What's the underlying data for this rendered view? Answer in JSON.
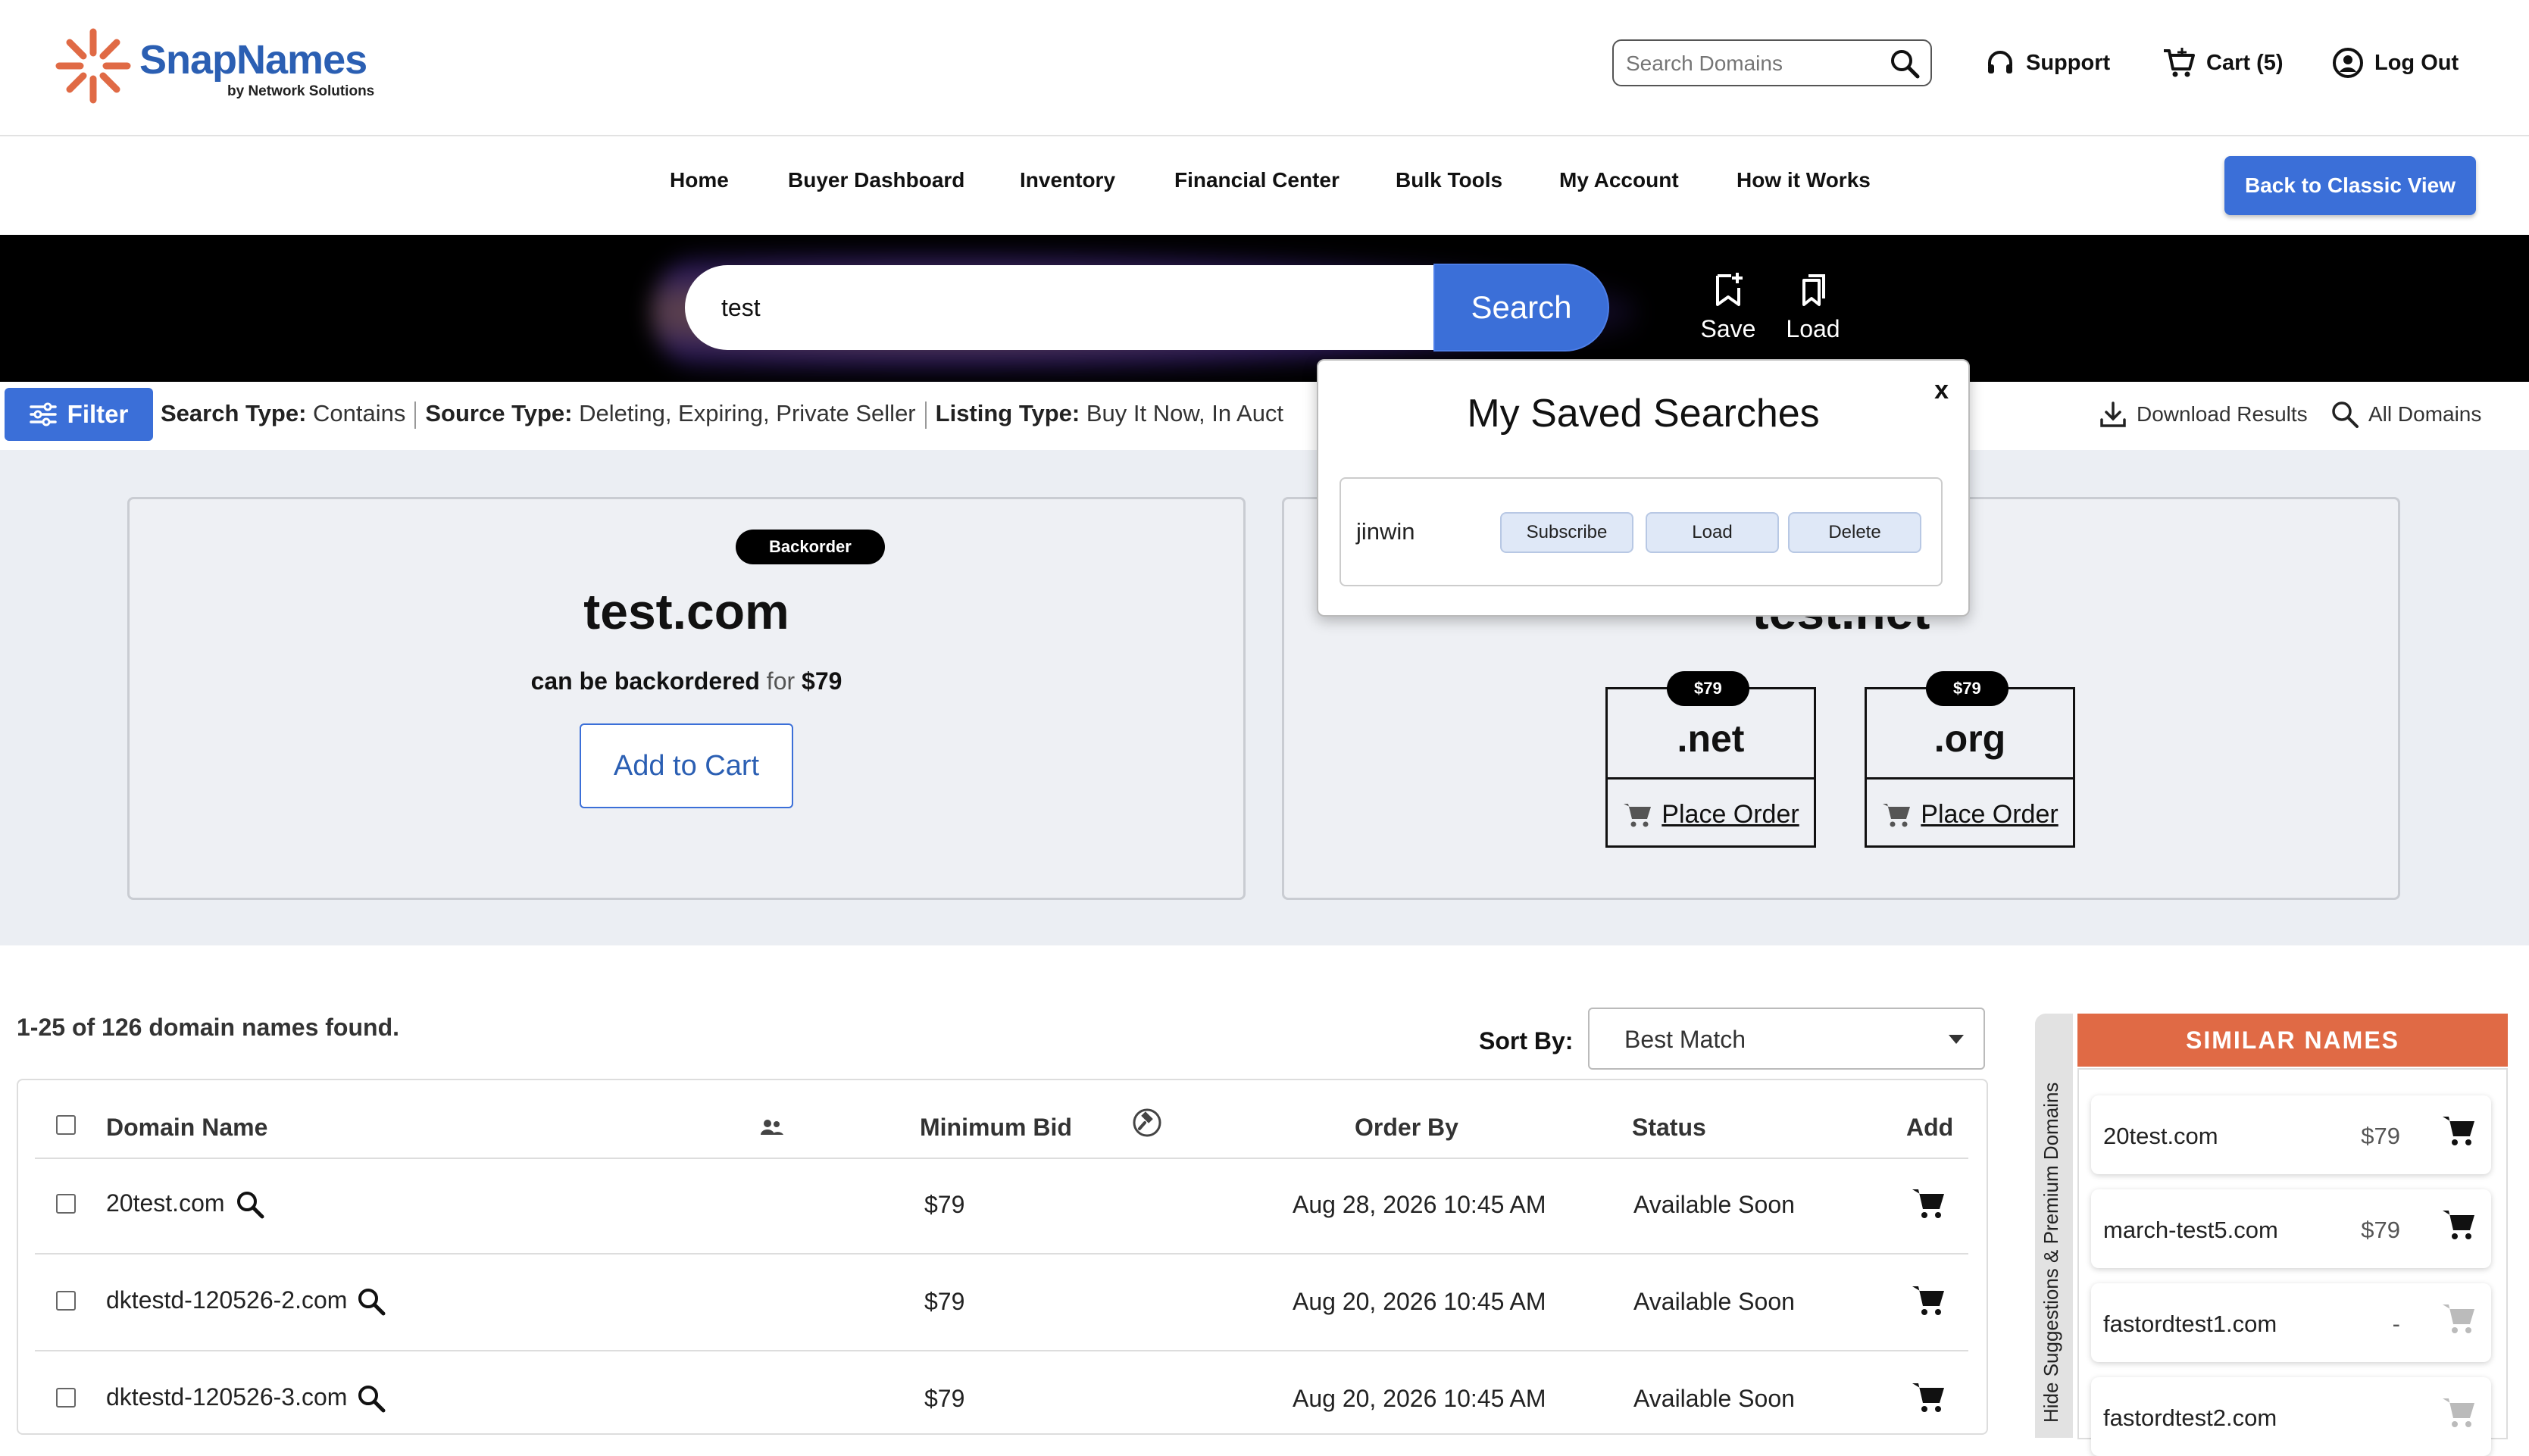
{
  "header": {
    "logo_name": "SnapNames",
    "logo_byline": "by Network Solutions",
    "search_placeholder": "Search Domains",
    "support": "Support",
    "cart": "Cart (5)",
    "logout": "Log Out"
  },
  "nav": {
    "items": [
      "Home",
      "Buyer Dashboard",
      "Inventory",
      "Financial Center",
      "Bulk Tools",
      "My Account",
      "How it Works"
    ],
    "classic_view": "Back to Classic View"
  },
  "hero": {
    "query": "test",
    "search_button": "Search",
    "save": "Save",
    "load": "Load"
  },
  "filterbar": {
    "filter_button": "Filter",
    "criteria": [
      {
        "label": "Search Type:",
        "value": "Contains"
      },
      {
        "label": "Source Type:",
        "value": "Deleting, Expiring, Private Seller"
      },
      {
        "label": "Listing Type:",
        "value": "Buy It Now, In Auct"
      }
    ],
    "download": "Download Results",
    "all_domains": "All Domains"
  },
  "featured_left": {
    "badge": "Backorder",
    "domain": "test.com",
    "lead": "can be backordered",
    "for": "for",
    "price": "$79",
    "button": "Add to Cart"
  },
  "featured_right": {
    "domain": "test.net",
    "tlds": [
      {
        "price": "$79",
        "ext": ".net",
        "action": "Place Order"
      },
      {
        "price": "$79",
        "ext": ".org",
        "action": "Place Order"
      }
    ]
  },
  "saved_searches": {
    "title": "My Saved Searches",
    "close": "x",
    "items": [
      {
        "name": "jinwin",
        "subscribe": "Subscribe",
        "load": "Load",
        "delete": "Delete"
      }
    ]
  },
  "results": {
    "count_text": "1-25 of 126 domain names found.",
    "sort_label": "Sort By:",
    "sort_value": "Best Match",
    "columns": {
      "domain": "Domain Name",
      "min_bid": "Minimum Bid",
      "order_by": "Order By",
      "status": "Status",
      "add": "Add"
    },
    "rows": [
      {
        "domain": "20test.com",
        "bid": "$79",
        "order_by": "Aug 28, 2026 10:45 AM",
        "status": "Available Soon"
      },
      {
        "domain": "dktestd-120526-2.com",
        "bid": "$79",
        "order_by": "Aug 20, 2026 10:45 AM",
        "status": "Available Soon"
      },
      {
        "domain": "dktestd-120526-3.com",
        "bid": "$79",
        "order_by": "Aug 20, 2026 10:45 AM",
        "status": "Available Soon"
      }
    ]
  },
  "similar": {
    "toggle": "Hide Suggestions & Premium Domains",
    "title": "SIMILAR NAMES",
    "items": [
      {
        "name": "20test.com",
        "price": "$79",
        "available": true
      },
      {
        "name": "march-test5.com",
        "price": "$79",
        "available": true
      },
      {
        "name": "fastordtest1.com",
        "price": "-",
        "available": false
      },
      {
        "name": "fastordtest2.com",
        "price": "",
        "available": false
      }
    ]
  },
  "colors": {
    "primary_blue": "#3b6fd8",
    "brand_orange": "#e06a45",
    "logo_blue": "#2b5fb3"
  }
}
